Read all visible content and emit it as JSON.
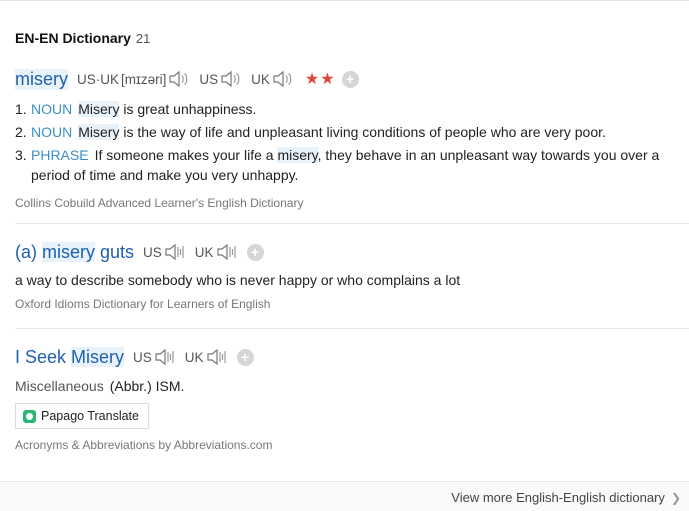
{
  "header": {
    "title": "EN-EN Dictionary",
    "count": "21"
  },
  "entry1": {
    "headword": "misery",
    "pron_usuk_label": "US·UK",
    "pron_ipa": "[mɪzəri]",
    "pron_us_label": "US",
    "pron_uk_label": "UK",
    "stars": "★★",
    "senses": [
      {
        "num": "1.",
        "pos": "NOUN",
        "hl": "Misery",
        "rest": " is great unhappiness."
      },
      {
        "num": "2.",
        "pos": "NOUN",
        "hl": "Misery",
        "rest": " is the way of life and unpleasant living conditions of people who are very poor."
      },
      {
        "num": "3.",
        "pos": "PHRASE",
        "pre": "If someone makes your life a ",
        "hl": "misery",
        "rest": ", they behave in an unpleasant way towards you over a period of time and make you very unhappy."
      }
    ],
    "source": "Collins Cobuild Advanced Learner's English Dictionary"
  },
  "entry2": {
    "hw_pre": "(a) ",
    "hw_hl": "misery",
    "hw_post": " guts",
    "pron_us_label": "US",
    "pron_uk_label": "UK",
    "definition": "a way to describe somebody who is never happy or who complains a lot",
    "source": "Oxford Idioms Dictionary for Learners of English"
  },
  "entry3": {
    "hw_pre": "I Seek ",
    "hw_hl": "Misery",
    "pron_us_label": "US",
    "pron_uk_label": "UK",
    "category": "Miscellaneous",
    "definition": "(Abbr.) ISM.",
    "papago_label": "Papago Translate",
    "source": "Acronyms & Abbreviations by Abbreviations.com"
  },
  "footer": {
    "more_label": "View more English-English dictionary"
  },
  "colors": {
    "headword": "#1f5fae",
    "pos": "#3a8fc7",
    "stars": "#e0453b",
    "highlight": "#e8f2fb"
  }
}
